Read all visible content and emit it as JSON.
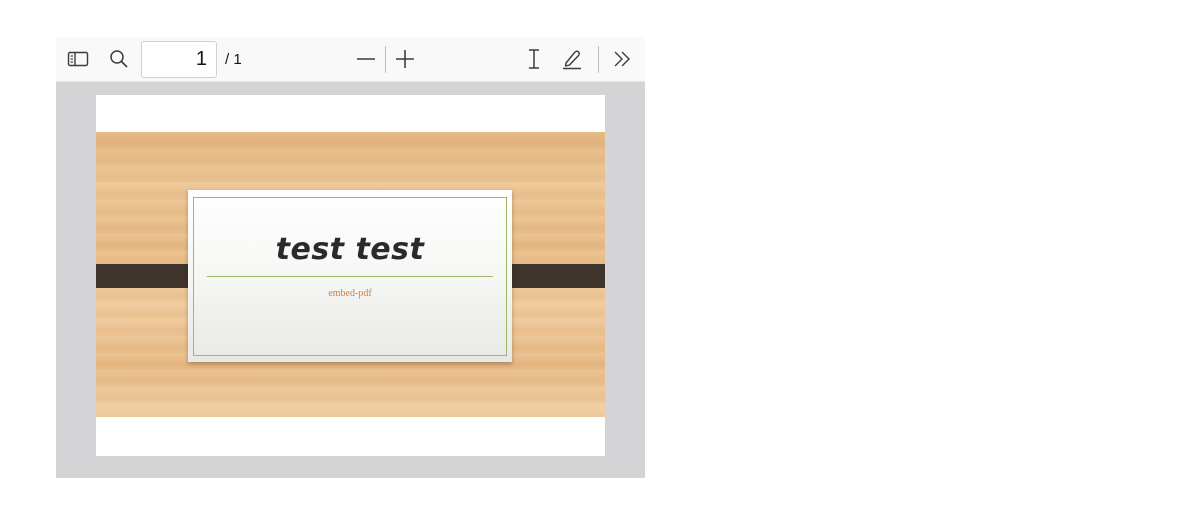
{
  "toolbar": {
    "page_number": "1",
    "page_total": "/ 1",
    "icons": {
      "sidebar": "sidebar-toggle-icon",
      "find": "search-icon",
      "zoom_out": "minus-icon",
      "zoom_in": "plus-icon",
      "text_select": "text-cursor-icon",
      "draw": "pen-icon",
      "more": "double-chevron-right-icon"
    }
  },
  "document": {
    "slide_title": "test test",
    "slide_subtitle": "embed-pdf"
  },
  "colors": {
    "viewer_background": "#d4d4d6",
    "toolbar_background": "#f9f9fa",
    "card_border": "#9cb86a",
    "subtitle_text": "#d27d45",
    "strap": "#3f342c"
  }
}
